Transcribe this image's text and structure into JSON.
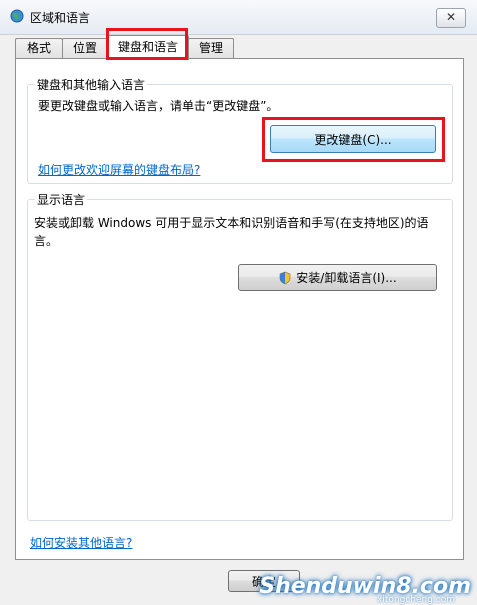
{
  "window": {
    "title": "区域和语言",
    "close_label": "✕"
  },
  "tabs": [
    {
      "label": "格式"
    },
    {
      "label": "位置"
    },
    {
      "label": "键盘和语言",
      "selected": true
    },
    {
      "label": "管理"
    }
  ],
  "keyboard_group": {
    "title": "键盘和其他输入语言",
    "description": "要更改键盘或输入语言，请单击“更改键盘”。",
    "change_button": "更改键盘(C)...",
    "help_link": "如何更改欢迎屏幕的键盘布局?"
  },
  "display_group": {
    "title": "显示语言",
    "description": "安装或卸载 Windows 可用于显示文本和识别语音和手写(在支持地区)的语言。",
    "install_button": "安装/卸载语言(I)...",
    "install_button_icon": "uac-shield-icon"
  },
  "footer": {
    "link": "如何安装其他语言?",
    "ok_button": "确定"
  },
  "watermark": {
    "main": "Shenduwin8.com",
    "sub": "xitongcheng.com"
  },
  "colors": {
    "highlight": "#e8141b",
    "link": "#0066cc"
  }
}
